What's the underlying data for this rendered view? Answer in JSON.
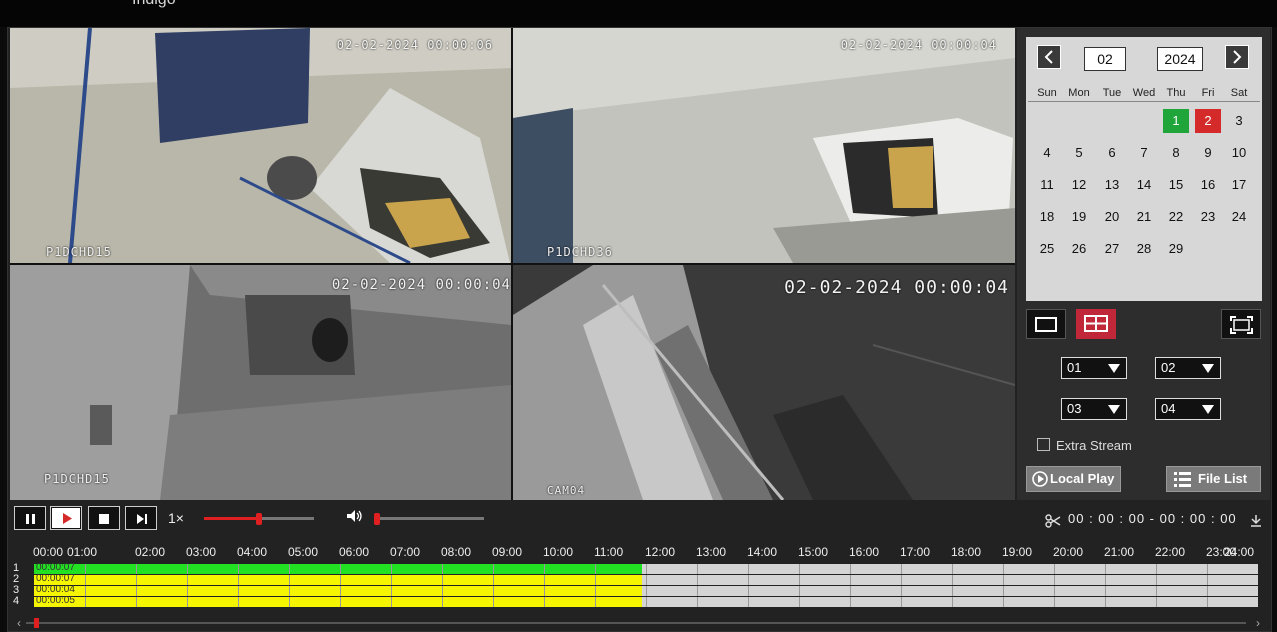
{
  "app": {
    "title": "Indigo"
  },
  "tiles": [
    {
      "timestamp": "02-02-2024 00:00:06",
      "camera": "P1DCHD15"
    },
    {
      "timestamp": "02-02-2024 00:00:04",
      "camera": "P1DCHD36"
    },
    {
      "timestamp": "02-02-2024 00:00:04",
      "camera": "P1DCHD15"
    },
    {
      "timestamp": "02-02-2024 00:00:04",
      "camera": "CAM04"
    }
  ],
  "calendar": {
    "month": "02",
    "year": "2024",
    "weekdays": [
      "Sun",
      "Mon",
      "Tue",
      "Wed",
      "Thu",
      "Fri",
      "Sat"
    ],
    "days": [
      "1",
      "2",
      "3",
      "4",
      "5",
      "6",
      "7",
      "8",
      "9",
      "10",
      "11",
      "12",
      "13",
      "14",
      "15",
      "16",
      "17",
      "18",
      "19",
      "20",
      "21",
      "22",
      "23",
      "24",
      "25",
      "26",
      "27",
      "28",
      "29"
    ],
    "recorded_day": "1",
    "selected_day": "2",
    "recorded_color": "#1fa53a",
    "selected_color": "#d42a2a"
  },
  "layout": {
    "single_icon": "single-view-icon",
    "quad_icon": "quad-view-icon",
    "fullscreen_icon": "fullscreen-icon",
    "active": "quad"
  },
  "channels": {
    "slot1": "01",
    "slot2": "02",
    "slot3": "03",
    "slot4": "04"
  },
  "extra_stream": {
    "label": "Extra Stream",
    "checked": false
  },
  "buttons": {
    "local_play": "Local Play",
    "file_list": "File List"
  },
  "playback": {
    "speed": "1×",
    "progress": 0.5,
    "volume": 0.0,
    "clip_range": "00 : 00 : 00 - 00 : 00 : 00"
  },
  "timeline": {
    "hours": [
      "00:00",
      "01:00",
      "02:00",
      "03:00",
      "04:00",
      "05:00",
      "06:00",
      "07:00",
      "08:00",
      "09:00",
      "10:00",
      "11:00",
      "12:00",
      "13:00",
      "14:00",
      "15:00",
      "16:00",
      "17:00",
      "18:00",
      "19:00",
      "20:00",
      "21:00",
      "22:00",
      "23:00",
      "24:00"
    ],
    "tracks": [
      {
        "row": "1",
        "label": "00:00:07",
        "color": "#22e022",
        "fraction": 0.4965
      },
      {
        "row": "2",
        "label": "00:00:07",
        "color": "#f5f500",
        "fraction": 0.4965
      },
      {
        "row": "3",
        "label": "00:00:04",
        "color": "#f5f500",
        "fraction": 0.4965
      },
      {
        "row": "4",
        "label": "00:00:05",
        "color": "#f5f500",
        "fraction": 0.4965
      }
    ]
  }
}
